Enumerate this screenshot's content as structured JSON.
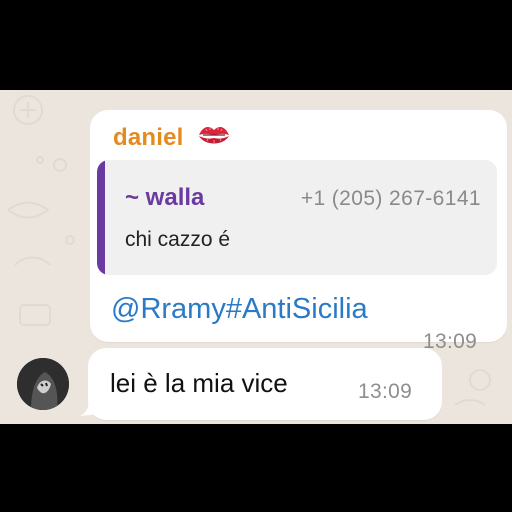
{
  "messages": [
    {
      "sender": "daniel",
      "sender_emoji": "kiss-mark-icon",
      "quoted": {
        "author": "~ walla",
        "phone": "+1 (205) 267-6141",
        "text": "chi cazzo é"
      },
      "text": "@Rramy#AntiSicilia",
      "time": "13:09"
    },
    {
      "text": "lei è la mia vice",
      "time": "13:09"
    }
  ],
  "colors": {
    "sender": "#e58a1f",
    "quote_accent": "#6b3aa0",
    "mention": "#2a7ac8",
    "chat_background": "#ece5dd"
  }
}
